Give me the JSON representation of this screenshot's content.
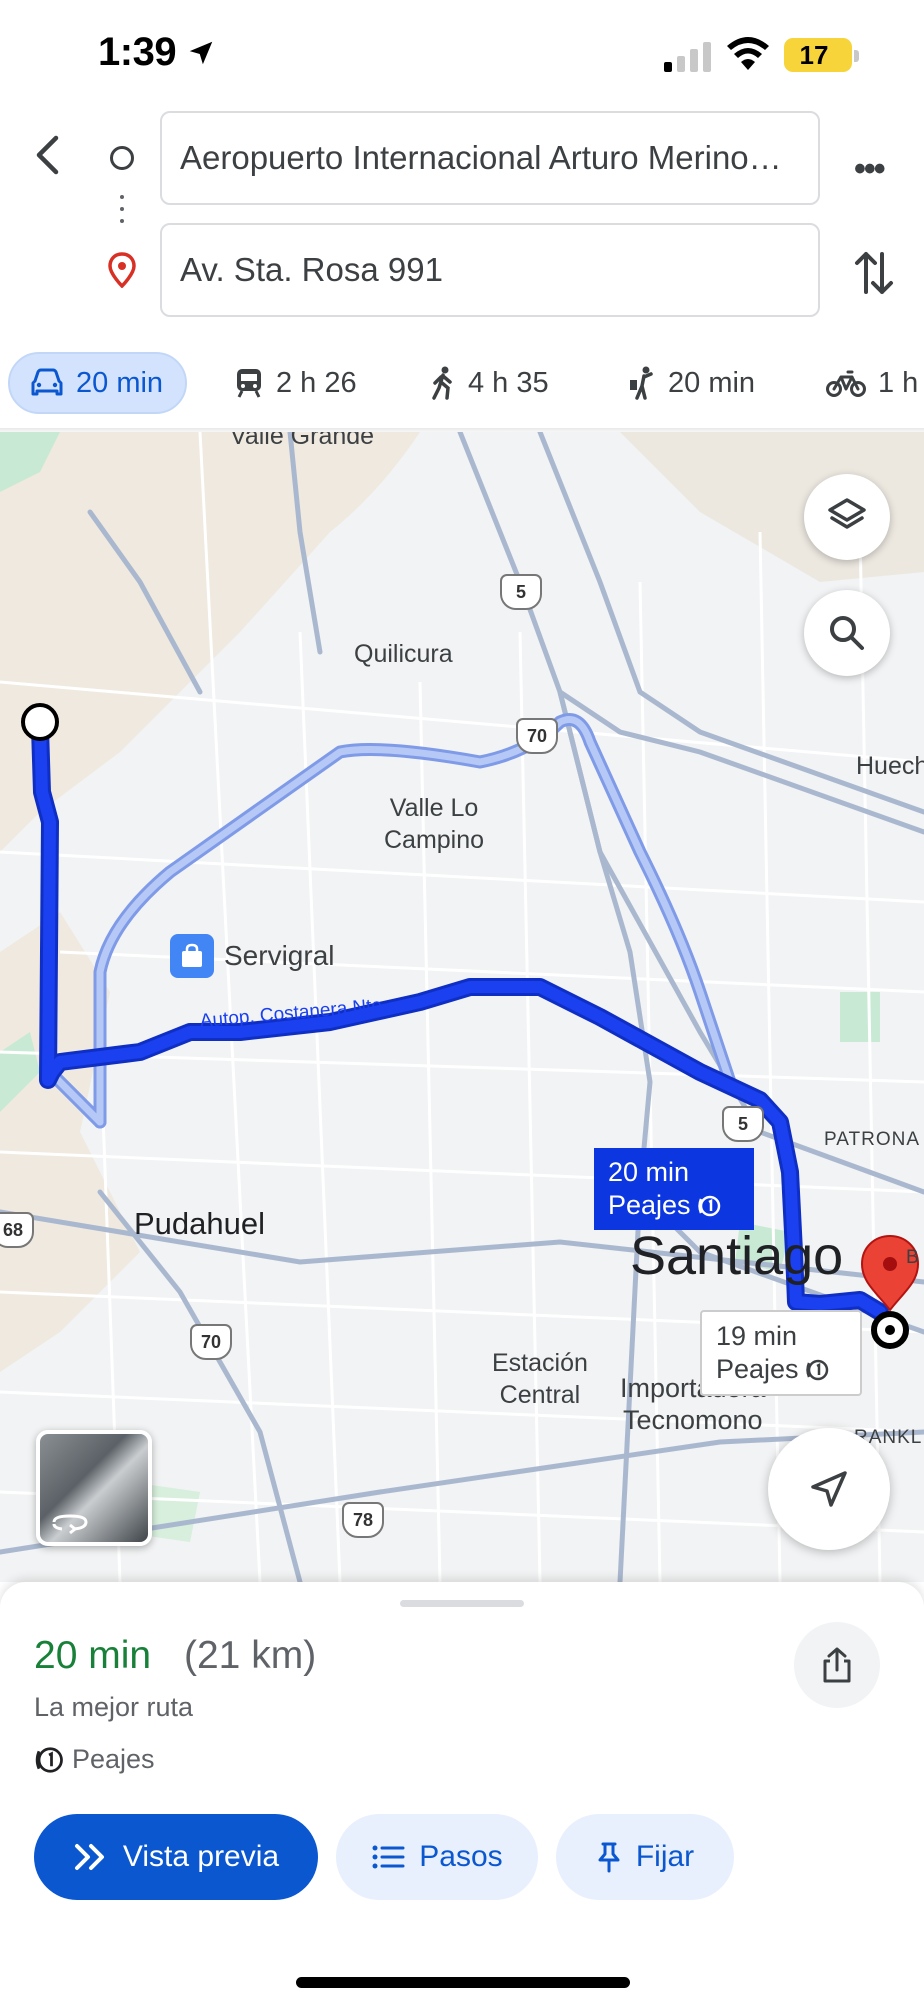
{
  "status_bar": {
    "time": "1:39",
    "battery": "17"
  },
  "route": {
    "origin": "Aeropuerto Internacional Arturo Merino…",
    "destination": "Av. Sta. Rosa 991"
  },
  "modes": [
    {
      "icon": "car-icon",
      "label": "20 min",
      "active": true
    },
    {
      "icon": "transit-icon",
      "label": "2 h 26"
    },
    {
      "icon": "walk-icon",
      "label": "4 h 35"
    },
    {
      "icon": "rideshare-icon",
      "label": "20 min"
    },
    {
      "icon": "bike-icon",
      "label": "1 h"
    }
  ],
  "map": {
    "labels": {
      "valle_grande": "Valle Grande",
      "quilicura": "Quilicura",
      "valle_lo_campino": "Valle Lo\nCampino",
      "huechuraba": "Huech",
      "pudahuel": "Pudahuel",
      "santiago": "Santiago",
      "estacion_central": "Estación\nCentral",
      "tecnomono": "Importadora\nTecnomono",
      "patronato": "PATRONA",
      "franklin": "RANKL",
      "costanera": "Autop. Costanera Nte.",
      "b": "B"
    },
    "shields": [
      "5",
      "70",
      "5",
      "68",
      "70",
      "78"
    ],
    "poi": "Servigral",
    "callout_primary": {
      "time": "20 min",
      "toll": "Peajes"
    },
    "callout_alt": {
      "time": "19 min",
      "toll": "Peajes"
    }
  },
  "sheet": {
    "duration": "20 min",
    "distance": "(21 km)",
    "subtitle": "La mejor ruta",
    "toll": "Peajes",
    "buttons": {
      "preview": "Vista previa",
      "steps": "Pasos",
      "pin": "Fijar"
    }
  },
  "colors": {
    "route": "#1a33e8",
    "alt_route": "#a9bdf5",
    "accent": "#0b57d0",
    "duration": "#188038"
  }
}
